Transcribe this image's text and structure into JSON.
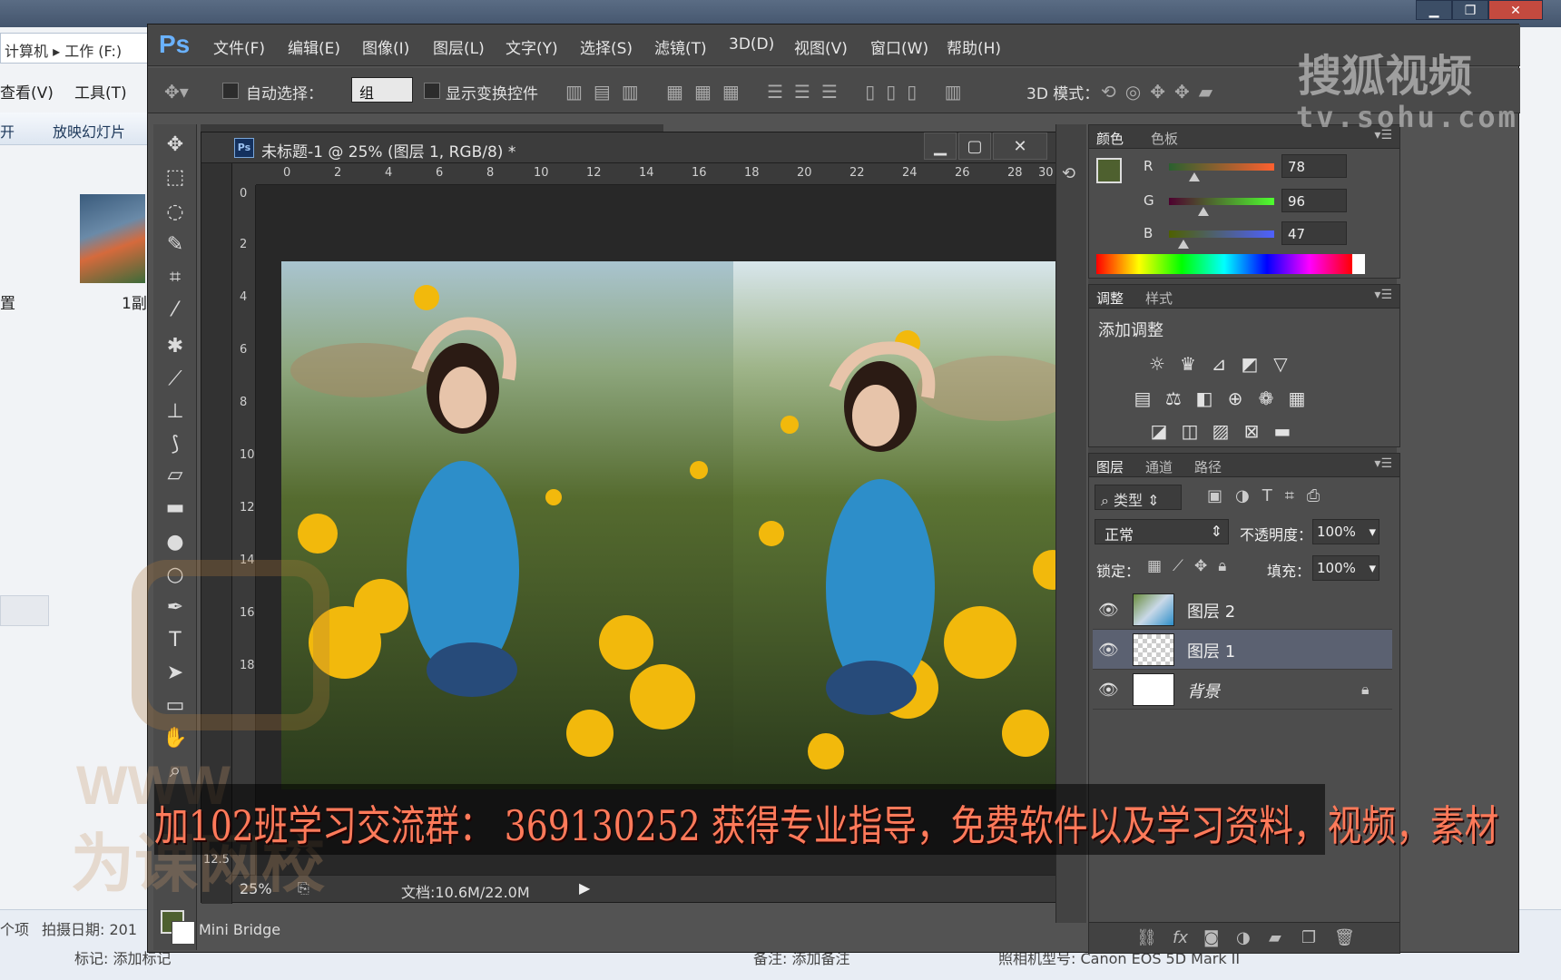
{
  "explorer": {
    "address_text": "计算机 ▸ 工作 (F:)",
    "menu": [
      "查看(V)",
      "工具(T)"
    ],
    "toolbar": [
      "开",
      "放映幻灯片"
    ],
    "side_label": "置",
    "thumb_label": "1副",
    "status": {
      "items": "个项",
      "date": "拍摄日期: 201",
      "tag": "标记: 添加标记",
      "note": "备注: 添加备注",
      "camera": "照相机型号: Canon EOS 5D Mark II"
    }
  },
  "window_controls": [
    "▁",
    "❐",
    "✕"
  ],
  "ps": {
    "logo": "Ps",
    "menu": [
      "文件(F)",
      "编辑(E)",
      "图像(I)",
      "图层(L)",
      "文字(Y)",
      "选择(S)",
      "滤镜(T)",
      "3D(D)",
      "视图(V)",
      "窗口(W)",
      "帮助(H)"
    ],
    "options": {
      "auto_select": "自动选择：",
      "group_value": "组",
      "show_transform": "显示变换控件",
      "mode_3d": "3D 模式："
    },
    "document": {
      "tab_icon": "Ps",
      "title": "未标题-1 @ 25% (图层 1, RGB/8) *",
      "ruler_h": [
        "0",
        "2",
        "4",
        "6",
        "8",
        "10",
        "12",
        "14",
        "16",
        "18",
        "20",
        "22",
        "24",
        "26",
        "28",
        "30"
      ],
      "ruler_v": [
        "0",
        "2",
        "4",
        "6",
        "8",
        "10",
        "12",
        "14",
        "16",
        "18"
      ],
      "zoom": "25%",
      "doc_info": "文档:10.6M/22.0M",
      "left_zoom": "12.5"
    },
    "mini_bridge": "Mini Bridge",
    "color_panel": {
      "tabs": [
        "颜色",
        "色板"
      ],
      "channels": [
        {
          "label": "R",
          "value": "78"
        },
        {
          "label": "G",
          "value": "96"
        },
        {
          "label": "B",
          "value": "47"
        }
      ],
      "fg_color": "#4e602f"
    },
    "adjust_panel": {
      "tabs": [
        "调整",
        "样式"
      ],
      "title": "添加调整"
    },
    "layers_panel": {
      "tabs": [
        "图层",
        "通道",
        "路径"
      ],
      "filter_label": "类型",
      "blend_mode": "正常",
      "opacity_label": "不透明度：",
      "opacity_value": "100%",
      "lock_label": "锁定：",
      "fill_label": "填充：",
      "fill_value": "100%",
      "layers": [
        {
          "name": "图层 2",
          "active": false
        },
        {
          "name": "图层 1",
          "active": true
        },
        {
          "name": "背景",
          "active": false
        }
      ]
    }
  },
  "banner_text": "加102班学习交流群： 369130252 获得专业指导，免费软件以及学习资料，视频，素材",
  "watermark": {
    "title": "搜狐视频",
    "url": "tv.sohu.com"
  },
  "logo_overlay": {
    "line1": "WWW",
    "line2": "为课网校"
  }
}
